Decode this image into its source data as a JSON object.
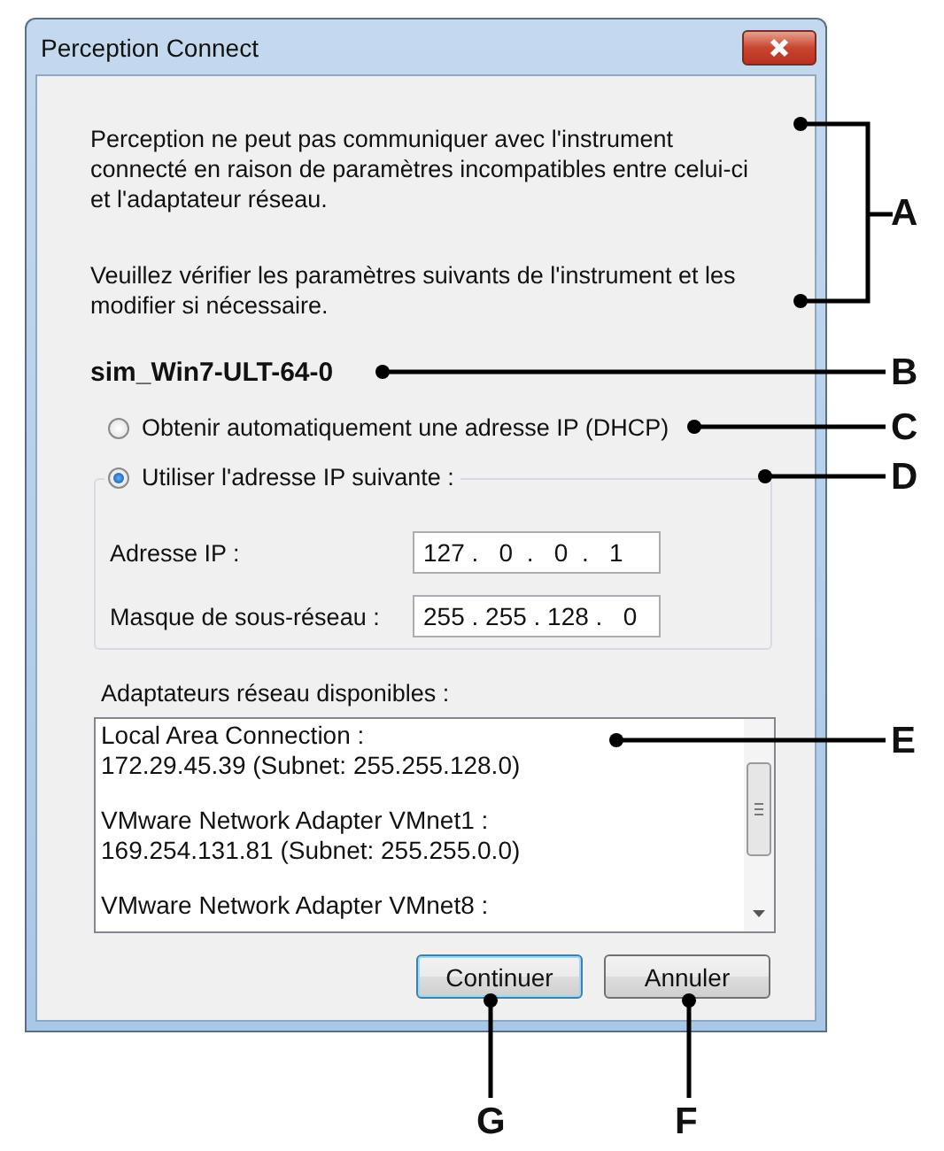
{
  "window": {
    "title": "Perception Connect"
  },
  "message": [
    "Perception ne peut pas communiquer avec l'instrument\nconnecté en raison de paramètres incompatibles entre celui-ci\net l'adaptateur réseau.",
    "Veuillez vérifier les paramètres suivants de l'instrument et les\nmodifier si nécessaire."
  ],
  "instrument_name": "sim_Win7-ULT-64-0",
  "ip_options": [
    {
      "label": "Obtenir automatiquement une adresse IP (DHCP)",
      "selected": false
    },
    {
      "label": "Utiliser l'adresse IP suivante :",
      "selected": true
    }
  ],
  "fields": [
    {
      "label": "Adresse IP :",
      "value": "127 .   0  .   0  .   1"
    },
    {
      "label": "Masque de sous-réseau :",
      "value": "255 . 255 . 128 .   0"
    }
  ],
  "adapters_label": "Adaptateurs réseau disponibles :",
  "adapters": [
    {
      "name": "Local Area Connection :",
      "address": "172.29.45.39 (Subnet: 255.255.128.0)"
    },
    {
      "name": "VMware Network Adapter VMnet1 :",
      "address": "169.254.131.81 (Subnet: 255.255.0.0)"
    },
    {
      "name": "VMware Network Adapter VMnet8 :"
    }
  ],
  "buttons": [
    {
      "label": "Continuer",
      "default": true
    },
    {
      "label": "Annuler",
      "default": false
    }
  ],
  "callouts": [
    "A",
    "B",
    "C",
    "D",
    "E",
    "F",
    "G"
  ]
}
